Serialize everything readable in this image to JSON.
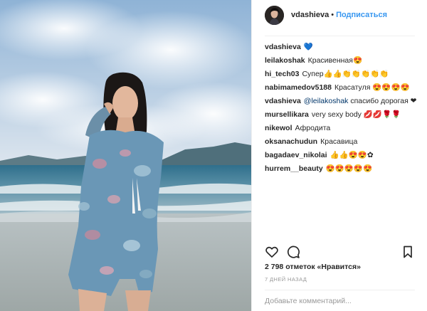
{
  "header": {
    "username": "vdashieva",
    "separator": "•",
    "follow_label": "Подписаться"
  },
  "comments": [
    {
      "user": "vdashieva",
      "mention": "",
      "text": "💙"
    },
    {
      "user": "leilakoshak",
      "mention": "",
      "text": "Красивенная😍"
    },
    {
      "user": "hi_tech03",
      "mention": "",
      "text": "Супер👍👍👏👏👏👏👏"
    },
    {
      "user": "nabimamedov5188",
      "mention": "",
      "text": "Красатуля 😍😍😍😍"
    },
    {
      "user": "vdashieva",
      "mention": "@leilakoshak",
      "text": " спасибо дорогая ❤"
    },
    {
      "user": "mursellikara",
      "mention": "",
      "text": "very sexy body 💋💋🌹🌹"
    },
    {
      "user": "nikewol",
      "mention": "",
      "text": "Афродита"
    },
    {
      "user": "oksanachudun",
      "mention": "",
      "text": "Красавица"
    },
    {
      "user": "bagadaev_nikolai",
      "mention": "",
      "text": "👍👍😍😍✿"
    },
    {
      "user": "hurrem__beauty",
      "mention": "",
      "text": "😍😍😍😍😍"
    }
  ],
  "actions": {
    "like_icon": "heart-outline",
    "comment_icon": "speech-bubble",
    "save_icon": "bookmark-outline"
  },
  "likes_text": "2 798 отметок «Нравится»",
  "timestamp": "7 дней назад",
  "add_comment_placeholder": "Добавьте комментарий...",
  "colors": {
    "link_blue": "#3897f0",
    "mention_blue": "#003569",
    "muted_gray": "#999999"
  }
}
